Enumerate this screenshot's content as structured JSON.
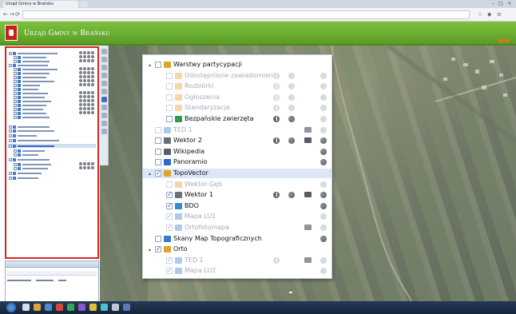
{
  "browser": {
    "tab_title": "Urząd Gminy w Brańsku",
    "url": "",
    "nav": {
      "back": "←",
      "forward": "→",
      "reload": "⟳"
    }
  },
  "app": {
    "title": "Urząd Gminy w Brańsku"
  },
  "layer_tree": {
    "items": [
      {
        "label": "Warstwy partycypacji",
        "level": 0,
        "expander": "▴",
        "checked": false,
        "icon_color": "#e0a42a",
        "disabled": false,
        "controls": [],
        "selected": false
      },
      {
        "label": "Udostępnione zawiadomienia",
        "level": 1,
        "checked": false,
        "icon_color": "#f0a040",
        "disabled": true,
        "controls": [
          "info",
          "globe",
          "",
          "light"
        ],
        "selected": false
      },
      {
        "label": "Rozbiórki",
        "level": 1,
        "checked": false,
        "icon_color": "#f0a040",
        "disabled": true,
        "controls": [
          "info",
          "globe",
          "",
          "light"
        ],
        "selected": false
      },
      {
        "label": "Ogłoszenia",
        "level": 1,
        "checked": false,
        "icon_color": "#f0a040",
        "disabled": true,
        "controls": [
          "info",
          "globe",
          "",
          "light"
        ],
        "selected": false
      },
      {
        "label": "Standaryzacja",
        "level": 1,
        "checked": false,
        "icon_color": "#f0a040",
        "disabled": true,
        "controls": [
          "info",
          "globe",
          "",
          "light"
        ],
        "selected": false
      },
      {
        "label": "Bezpańskie zwierzęta",
        "level": 1,
        "checked": false,
        "icon_color": "#2e9c4a",
        "disabled": false,
        "controls": [
          "info-dark",
          "globe-dark",
          "",
          "light"
        ],
        "selected": false
      },
      {
        "label": "TED 1",
        "level": 0,
        "checked": false,
        "icon_color": "#4a8ad0",
        "disabled": true,
        "controls": [
          "",
          "",
          "print",
          "light"
        ],
        "selected": false
      },
      {
        "label": "Wektor 2",
        "level": 0,
        "checked": false,
        "icon_color": "#6a6e76",
        "disabled": false,
        "controls": [
          "info-dark",
          "globe-dark",
          "print-dark",
          "globe-dark"
        ],
        "selected": false
      },
      {
        "label": "Wikipedia",
        "level": 0,
        "checked": false,
        "icon_color": "#5a5e66",
        "disabled": false,
        "controls": [
          "",
          "",
          "",
          "globe-dark"
        ],
        "selected": false
      },
      {
        "label": "Panoramio",
        "level": 0,
        "checked": false,
        "icon_color": "#2a6ac8",
        "disabled": false,
        "controls": [
          "",
          "",
          "",
          "globe-dark"
        ],
        "selected": false
      },
      {
        "label": "TopoVector",
        "level": 0,
        "expander": "▴",
        "checked": true,
        "icon_color": "#e0a42a",
        "disabled": false,
        "controls": [],
        "selected": true
      },
      {
        "label": "Wektor-Gęb",
        "level": 1,
        "checked": false,
        "icon_color": "#f0a040",
        "disabled": true,
        "controls": [
          "",
          "",
          "",
          "light"
        ],
        "selected": false
      },
      {
        "label": "Wektor 1",
        "level": 1,
        "checked": true,
        "icon_color": "#6a6e76",
        "disabled": false,
        "controls": [
          "info-dark",
          "globe-dark",
          "print-dark",
          "globe-dark"
        ],
        "selected": false
      },
      {
        "label": "BDO",
        "level": 1,
        "checked": true,
        "icon_color": "#3a8ad0",
        "disabled": false,
        "controls": [
          "",
          "",
          "",
          "globe-dark"
        ],
        "selected": false
      },
      {
        "label": "Mapa LU1",
        "level": 1,
        "checked": true,
        "icon_color": "#4a8ad0",
        "disabled": true,
        "controls": [
          "",
          "",
          "",
          "light"
        ],
        "selected": false
      },
      {
        "label": "Ortofotomapa",
        "level": 1,
        "checked": true,
        "icon_color": "#4a8ad0",
        "disabled": true,
        "controls": [
          "",
          "",
          "print",
          "light"
        ],
        "selected": false
      },
      {
        "label": "Skany Map Topograficznych",
        "level": 0,
        "checked": false,
        "icon_color": "#3a7ac8",
        "disabled": false,
        "controls": [
          "",
          "",
          "",
          "globe-dark"
        ],
        "selected": false
      },
      {
        "label": "Orto",
        "level": 0,
        "expander": "▴",
        "checked": true,
        "icon_color": "#e0a42a",
        "disabled": false,
        "controls": [],
        "selected": false
      },
      {
        "label": "TED 1",
        "level": 1,
        "checked": true,
        "icon_color": "#4a8ad0",
        "disabled": true,
        "controls": [
          "info",
          "",
          "print",
          "light"
        ],
        "selected": false
      },
      {
        "label": "Mapa LU2",
        "level": 1,
        "checked": true,
        "icon_color": "#4a8ad0",
        "disabled": true,
        "controls": [
          "",
          "",
          "",
          "light"
        ],
        "selected": false
      }
    ]
  },
  "taskbar": {
    "clock": ""
  }
}
